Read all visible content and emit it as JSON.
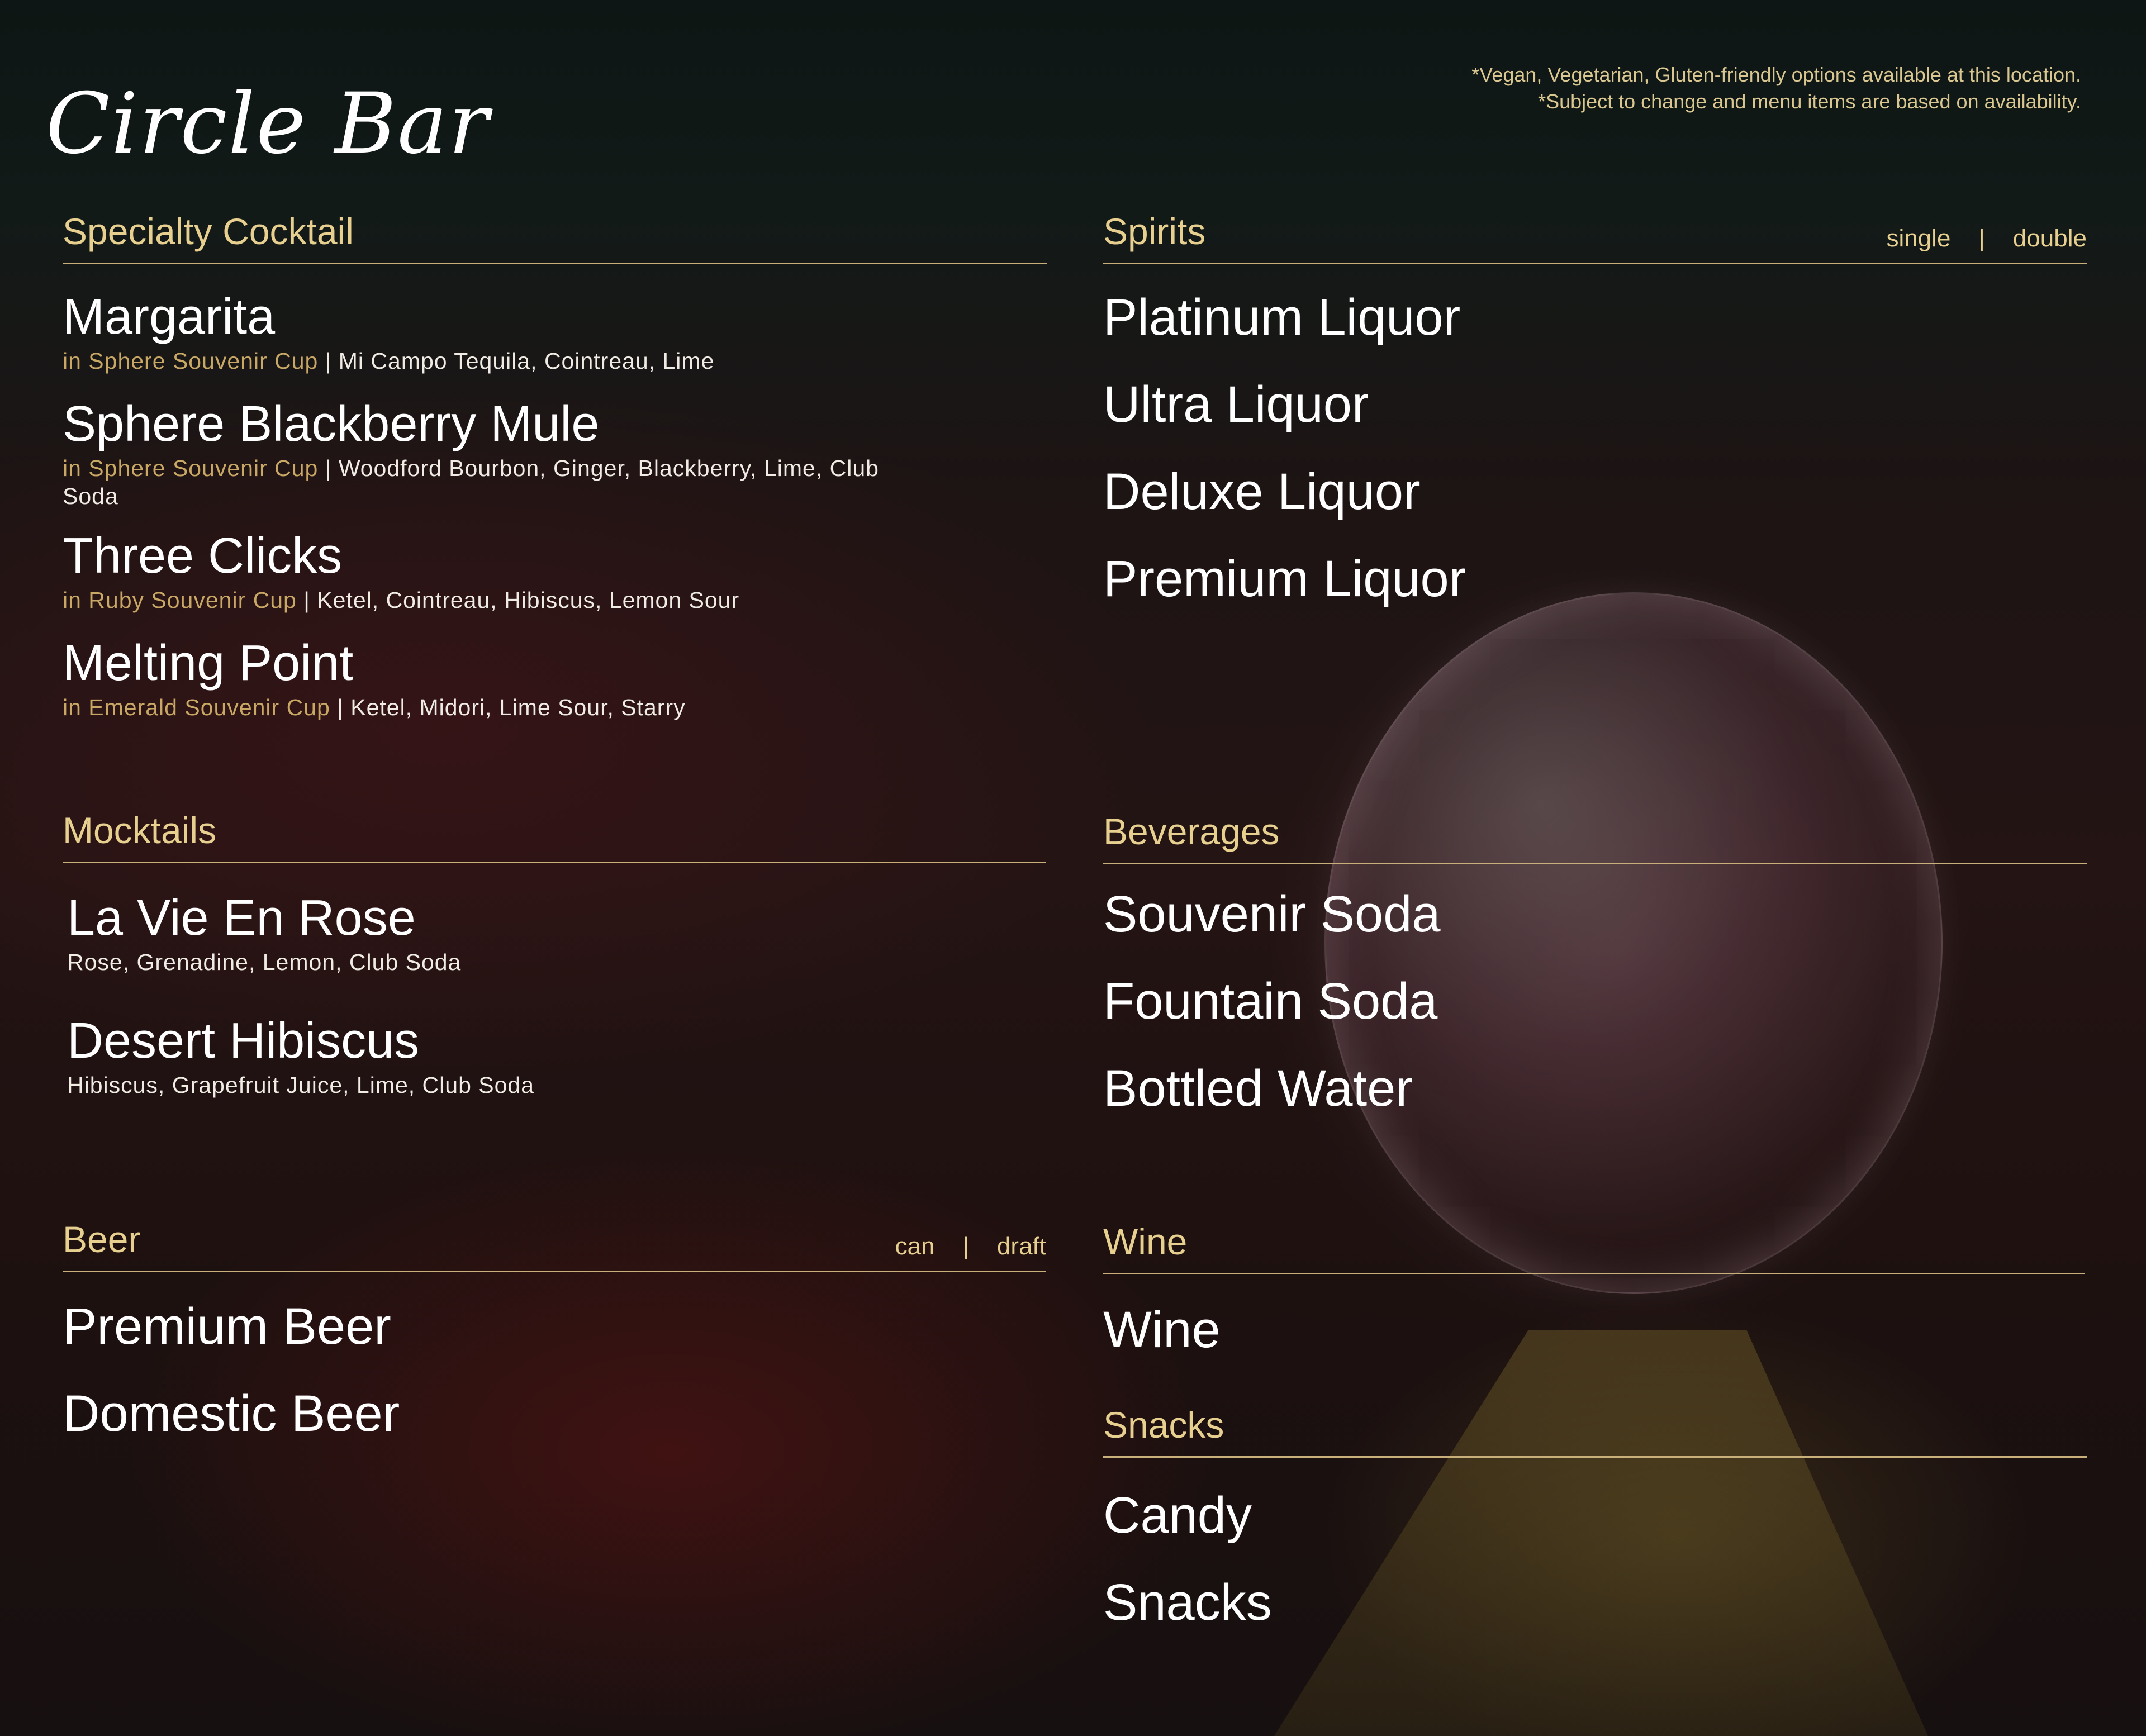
{
  "logo": {
    "text": "Circle Bar"
  },
  "notes": [
    "*Vegan, Vegetarian, Gluten-friendly options available at this location.",
    "*Subject to change and menu items are based on availability."
  ],
  "colors": {
    "gold": "#e6cf8f",
    "rule": "#c9b07a",
    "cup": "#c9a765",
    "text": "#ffffff"
  },
  "specialty": {
    "title": "Specialty Cocktail",
    "items": [
      {
        "name": "Margarita",
        "cup": "in Sphere Souvenir Cup",
        "sep": " | ",
        "ingredients": "Mi Campo Tequila, Cointreau, Lime"
      },
      {
        "name": "Sphere Blackberry Mule",
        "cup": "in Sphere Souvenir Cup",
        "sep": " | ",
        "ingredients": "Woodford Bourbon, Ginger, Blackberry, Lime, Club Soda"
      },
      {
        "name": "Three Clicks",
        "cup": "in Ruby Souvenir Cup",
        "sep": " | ",
        "ingredients": "Ketel, Cointreau, Hibiscus, Lemon Sour"
      },
      {
        "name": "Melting Point",
        "cup": "in Emerald Souvenir Cup",
        "sep": " | ",
        "ingredients": "Ketel, Midori, Lime Sour, Starry"
      }
    ]
  },
  "mocktails": {
    "title": "Mocktails",
    "items": [
      {
        "name": "La Vie En Rose",
        "ingredients": "Rose, Grenadine, Lemon, Club Soda"
      },
      {
        "name": "Desert Hibiscus",
        "ingredients": "Hibiscus, Grapefruit Juice, Lime, Club Soda"
      }
    ]
  },
  "beer": {
    "title": "Beer",
    "size_a": "can",
    "size_sep": "|",
    "size_b": "draft",
    "items": [
      "Premium Beer",
      "Domestic Beer"
    ]
  },
  "spirits": {
    "title": "Spirits",
    "size_a": "single",
    "size_sep": "|",
    "size_b": "double",
    "items": [
      "Platinum Liquor",
      "Ultra Liquor",
      "Deluxe Liquor",
      "Premium Liquor"
    ]
  },
  "beverages": {
    "title": "Beverages",
    "items": [
      "Souvenir Soda",
      "Fountain Soda",
      "Bottled Water"
    ]
  },
  "wine": {
    "title": "Wine",
    "items": [
      "Wine"
    ]
  },
  "snacks": {
    "title": "Snacks",
    "items": [
      "Candy",
      "Snacks"
    ]
  }
}
